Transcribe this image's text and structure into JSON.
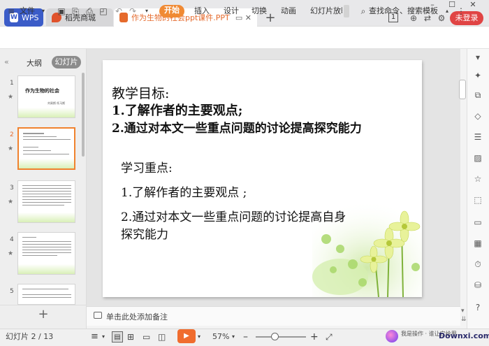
{
  "titlebar": {
    "tab_wps": "WPS",
    "tab_store": "稻壳商城",
    "tab_doc": "作为生物的社会ppt课件.PPT",
    "page_badge": "1",
    "login": "未登录"
  },
  "ribbon": {
    "file": "文件",
    "start": "开始",
    "insert": "插入",
    "design": "设计",
    "switch": "切换",
    "animation": "动画",
    "slideshow": "幻灯片放映",
    "search": "查找命令、搜索模板"
  },
  "leftpanel": {
    "outline": "大纲",
    "slides": "幻灯片",
    "thumb_numbers": [
      "1",
      "2",
      "3",
      "4",
      "5"
    ],
    "thumb1_title": "作为生物的社会",
    "thumb1_author": "刘易斯·托马斯"
  },
  "slide": {
    "goal_heading": "教学目标:",
    "goal_1": "1.了解作者的主要观点;",
    "goal_2": "2.通过对本文一些重点问题的讨论提高探究能力",
    "focus_heading": "学习重点:",
    "focus_1": "1.了解作者的主要观点 ;",
    "focus_2a": "2.通过对本文一些重点问题的讨论提高自身",
    "focus_2b": "探究能力"
  },
  "notes": {
    "placeholder": "单击此处添加备注"
  },
  "status": {
    "slide_info": "幻灯片 2 / 13",
    "zoom": "57%"
  },
  "watermark": {
    "text": "Downxi.com",
    "sub": "我是操作 · 谁让它给用"
  }
}
